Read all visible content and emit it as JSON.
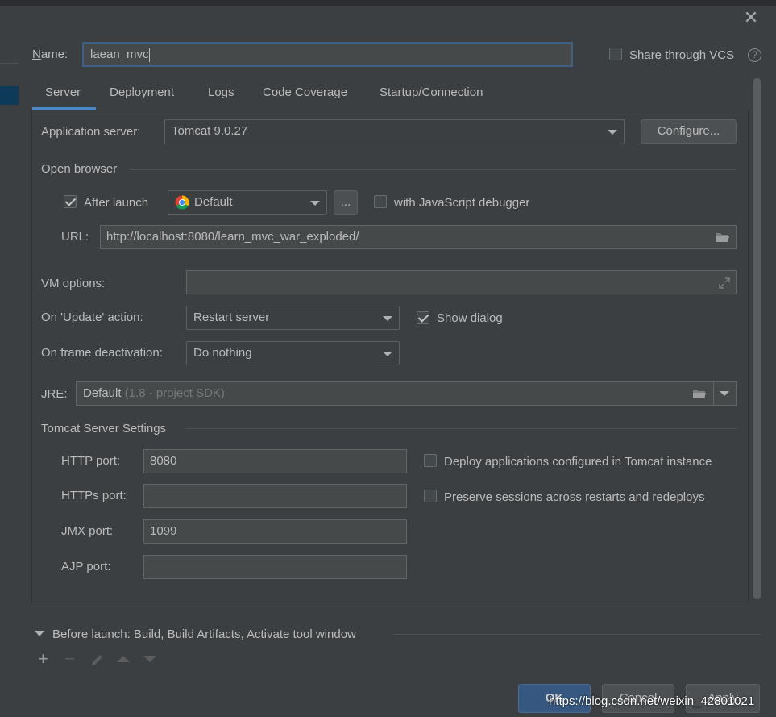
{
  "dialog": {
    "name_label": "Name:",
    "name_value": "laean_mvc",
    "share_vcs_label": "Share through VCS",
    "share_vcs_checked": false,
    "help_icon": "question-circle-icon",
    "close_icon": "close-icon"
  },
  "tabs": [
    {
      "label": "Server",
      "active": true
    },
    {
      "label": "Deployment",
      "active": false
    },
    {
      "label": "Logs",
      "active": false
    },
    {
      "label": "Code Coverage",
      "active": false
    },
    {
      "label": "Startup/Connection",
      "active": false
    }
  ],
  "server": {
    "app_server_label": "Application server:",
    "app_server_value": "Tomcat 9.0.27",
    "configure_label": "Configure...",
    "open_browser_label": "Open browser",
    "after_launch_label": "After launch",
    "after_launch_checked": true,
    "browser_value": "Default",
    "browser_icon": "chrome-icon",
    "more_label": "...",
    "js_debugger_label": "with JavaScript debugger",
    "js_debugger_checked": false,
    "url_label": "URL:",
    "url_value": "http://localhost:8080/learn_mvc_war_exploded/",
    "vm_options_label": "VM options:",
    "vm_options_value": "",
    "on_update_label": "On 'Update' action:",
    "on_update_value": "Restart server",
    "show_dialog_label": "Show dialog",
    "show_dialog_checked": true,
    "on_frame_label": "On frame deactivation:",
    "on_frame_value": "Do nothing",
    "jre_label": "JRE:",
    "jre_value": "Default",
    "jre_hint": "(1.8 - project SDK)",
    "tomcat_settings_label": "Tomcat Server Settings",
    "http_port_label": "HTTP port:",
    "http_port_value": "8080",
    "https_port_label": "HTTPs port:",
    "https_port_value": "",
    "jmx_port_label": "JMX port:",
    "jmx_port_value": "1099",
    "ajp_port_label": "AJP port:",
    "ajp_port_value": "",
    "deploy_apps_label": "Deploy applications configured in Tomcat instance",
    "deploy_apps_checked": false,
    "preserve_sessions_label": "Preserve sessions across restarts and redeploys",
    "preserve_sessions_checked": false
  },
  "before_launch": {
    "label": "Before launch: Build, Build Artifacts, Activate tool window",
    "tools": [
      "add-icon",
      "remove-icon",
      "edit-icon",
      "move-up-icon",
      "move-down-icon"
    ]
  },
  "footer": {
    "ok_label": "OK",
    "cancel_label": "Cancel",
    "apply_label": "Apply"
  },
  "watermark": "https://blog.csdn.net/weixin_42801021",
  "colors": {
    "background": "#3c3f41",
    "accent": "#4a88c7",
    "ok_button": "#365880"
  }
}
